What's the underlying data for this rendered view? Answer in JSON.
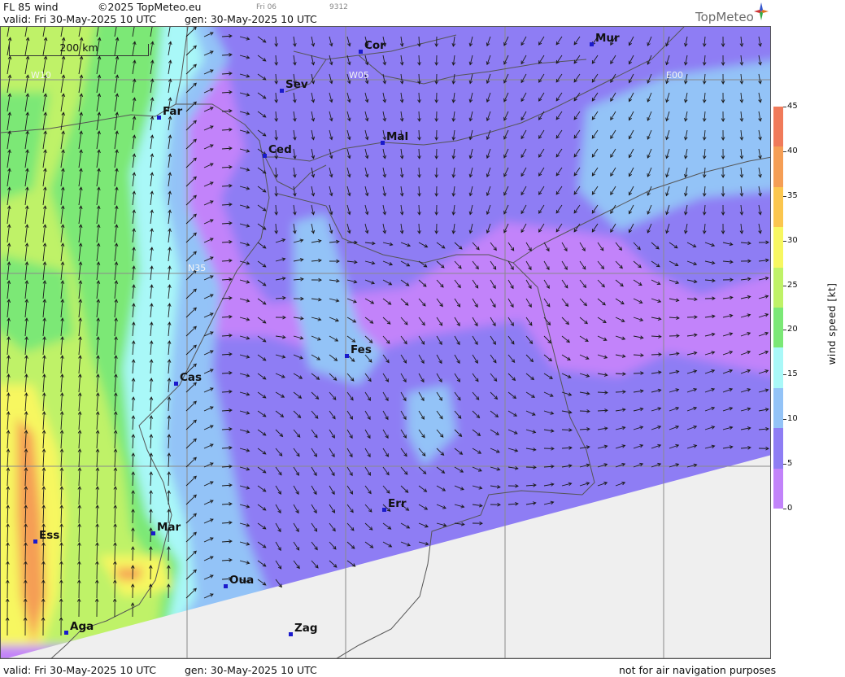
{
  "header": {
    "title": "FL 85 wind",
    "copyright": "©2025 TopMeteo.eu",
    "day_code": "Fri 06",
    "run_code": "9312",
    "valid": "valid:  Fri  30-May-2025  10 UTC",
    "generated": "gen: 30-May-2025 10 UTC",
    "logo": "TopMeteo"
  },
  "footer": {
    "valid": "valid:  Fri  30-May-2025  10 UTC",
    "generated": "gen: 30-May-2025 10 UTC",
    "notice": "not for air navigation purposes"
  },
  "map": {
    "scale_label": "200 km",
    "grid_labels": [
      "W10",
      "W05",
      "E00",
      "N35"
    ],
    "cities": [
      "Cor",
      "Mur",
      "Sev",
      "Far",
      "Mal",
      "Ced",
      "Fes",
      "Cas",
      "Err",
      "Mar",
      "Ess",
      "Oua",
      "Aga",
      "Zag"
    ]
  },
  "legend": {
    "unit": "wind  speed  [kt]",
    "ticks": [
      "45",
      "40",
      "35",
      "30",
      "25",
      "20",
      "15",
      "10",
      "5",
      "0"
    ],
    "colors": [
      "#f07a5a",
      "#f59e55",
      "#fbc64e",
      "#f7f760",
      "#bff267",
      "#7be876",
      "#a9f8f8",
      "#93c3f7",
      "#8e7df4",
      "#c283fa"
    ]
  },
  "colors": {
    "no_data": "#efefef",
    "border_line": "#555555",
    "grid_line": "#8a8a8a"
  }
}
